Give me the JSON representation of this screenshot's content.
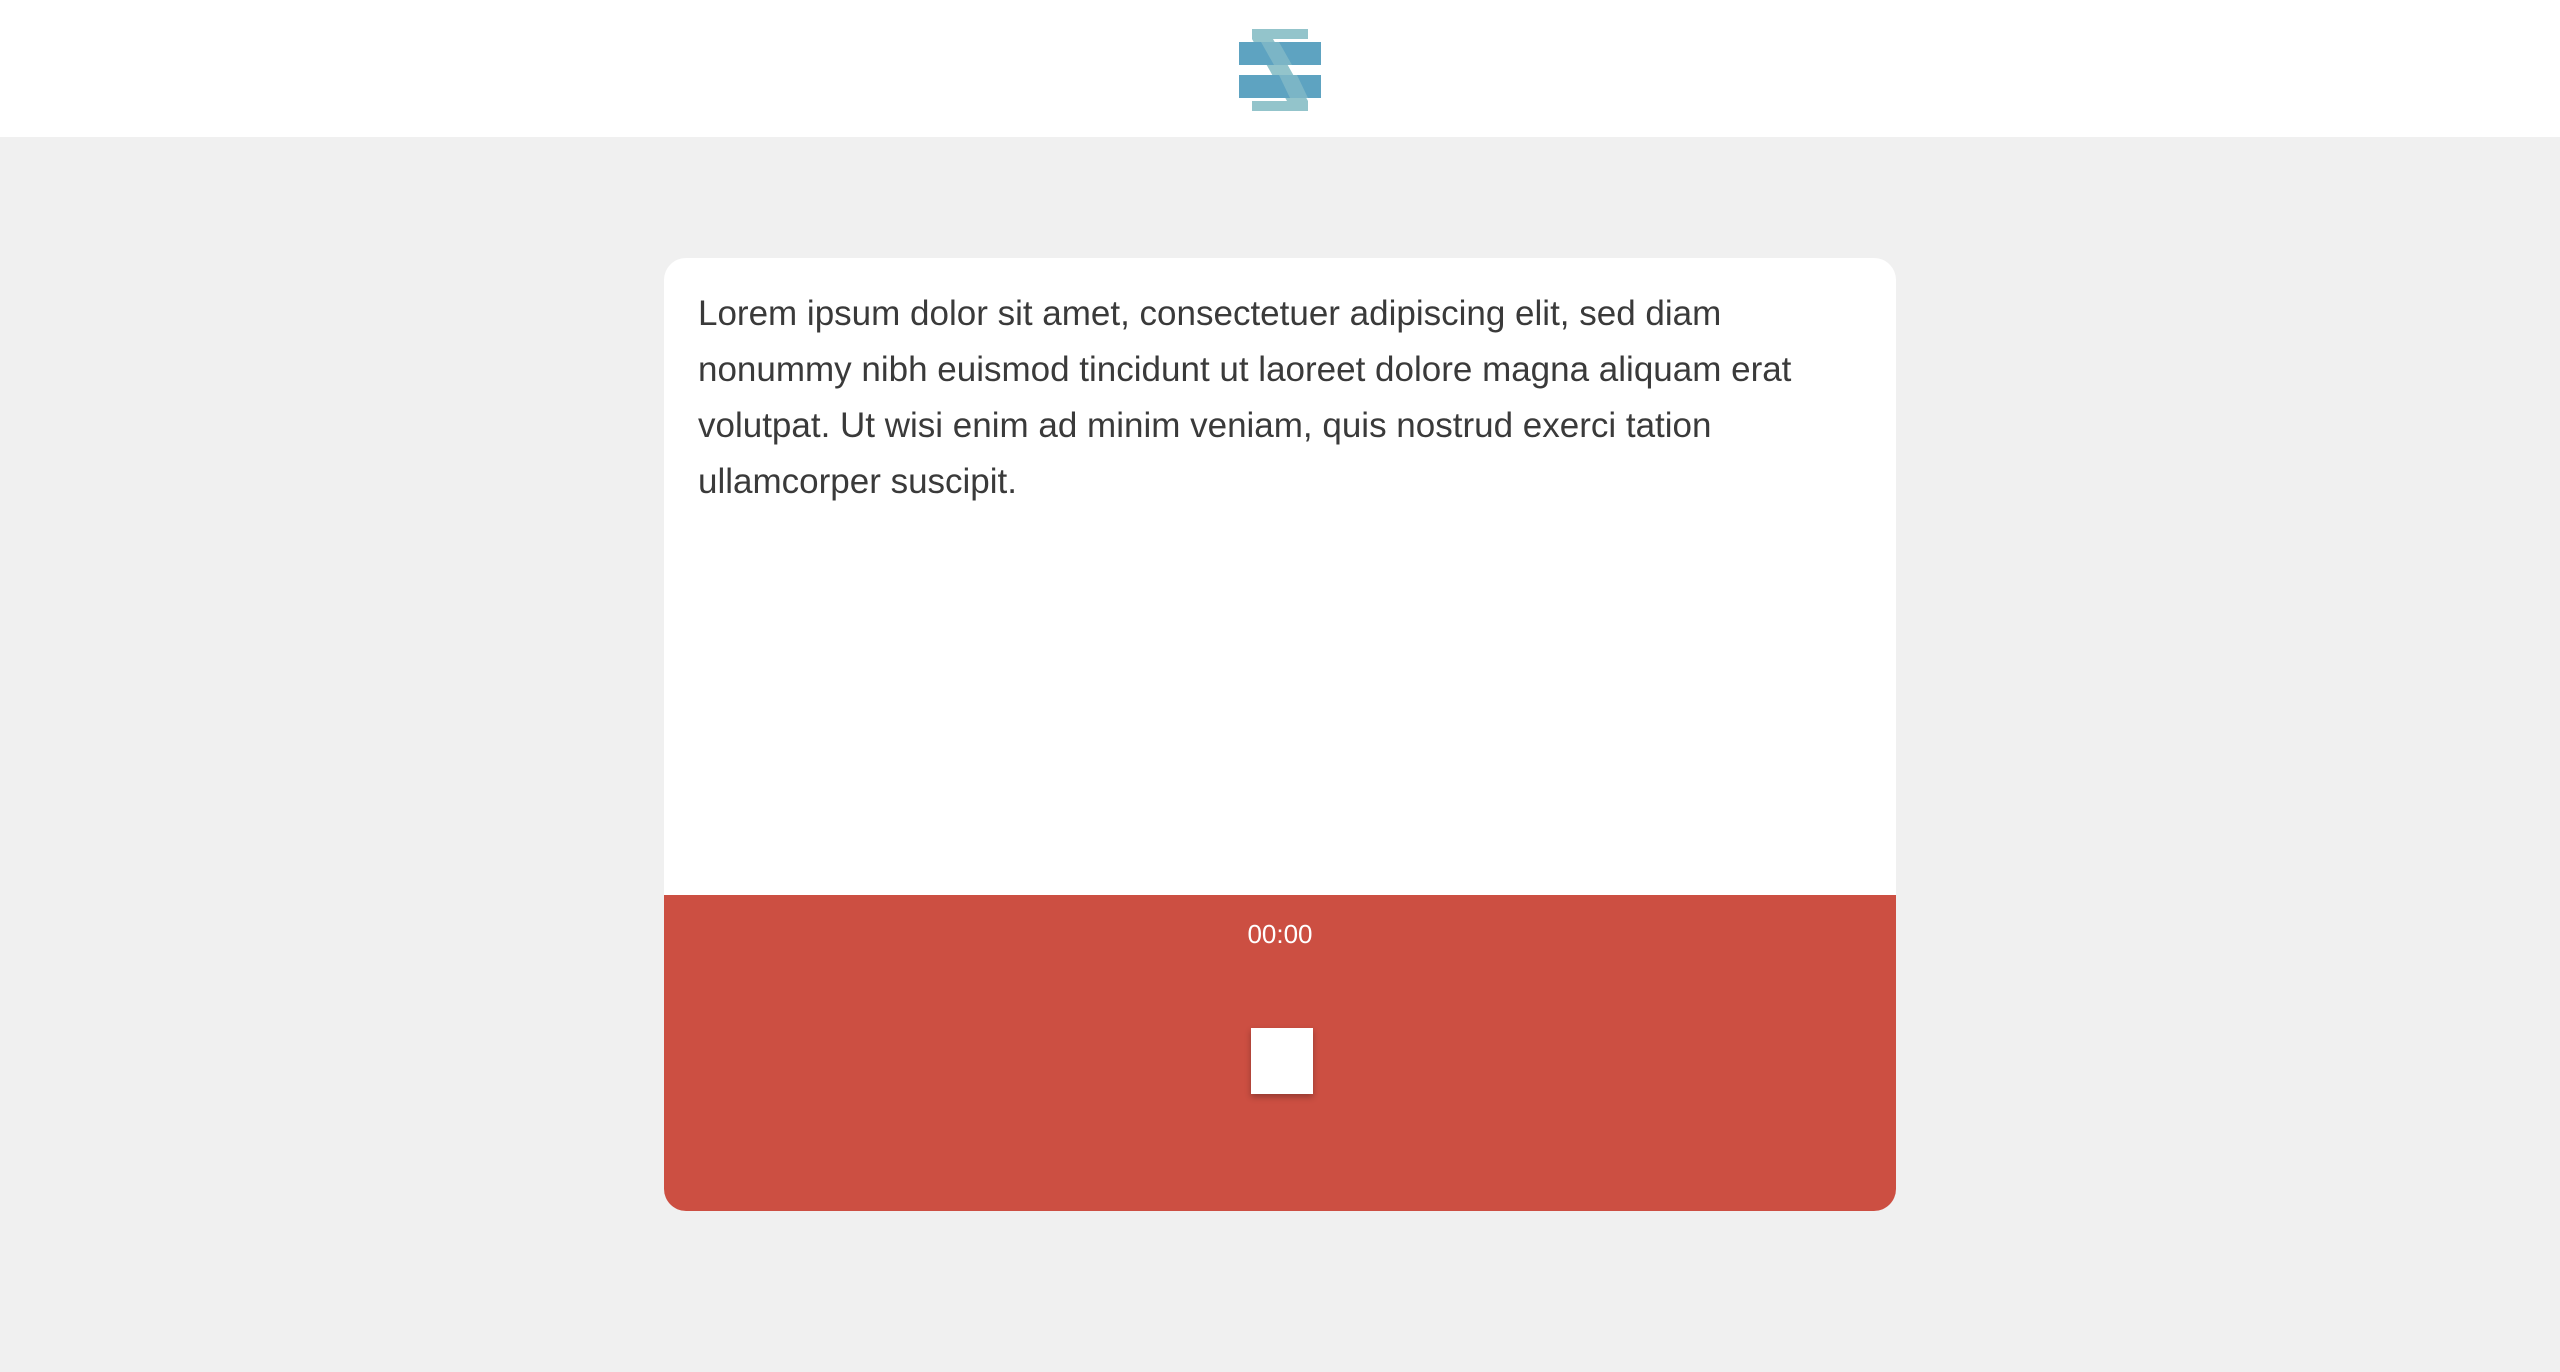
{
  "header": {
    "logo_icon": "stacked-stripes-logo-icon",
    "colors": {
      "stripe_dark": "#5ea3c1",
      "stripe_light": "#93c4cb"
    }
  },
  "card": {
    "text": "Lorem ipsum dolor sit amet, consectetuer adipiscing elit, sed diam nonummy nibh euismod tincidunt ut laoreet dolore magna aliquam erat volutpat. Ut wisi enim ad minim veniam, quis nostrud exerci tation ullamcorper suscipit."
  },
  "recorder": {
    "timer": "00:00",
    "stop_icon": "stop-square-icon",
    "background_color": "#cc4f42"
  },
  "page": {
    "background_color": "#f0f0f0"
  }
}
